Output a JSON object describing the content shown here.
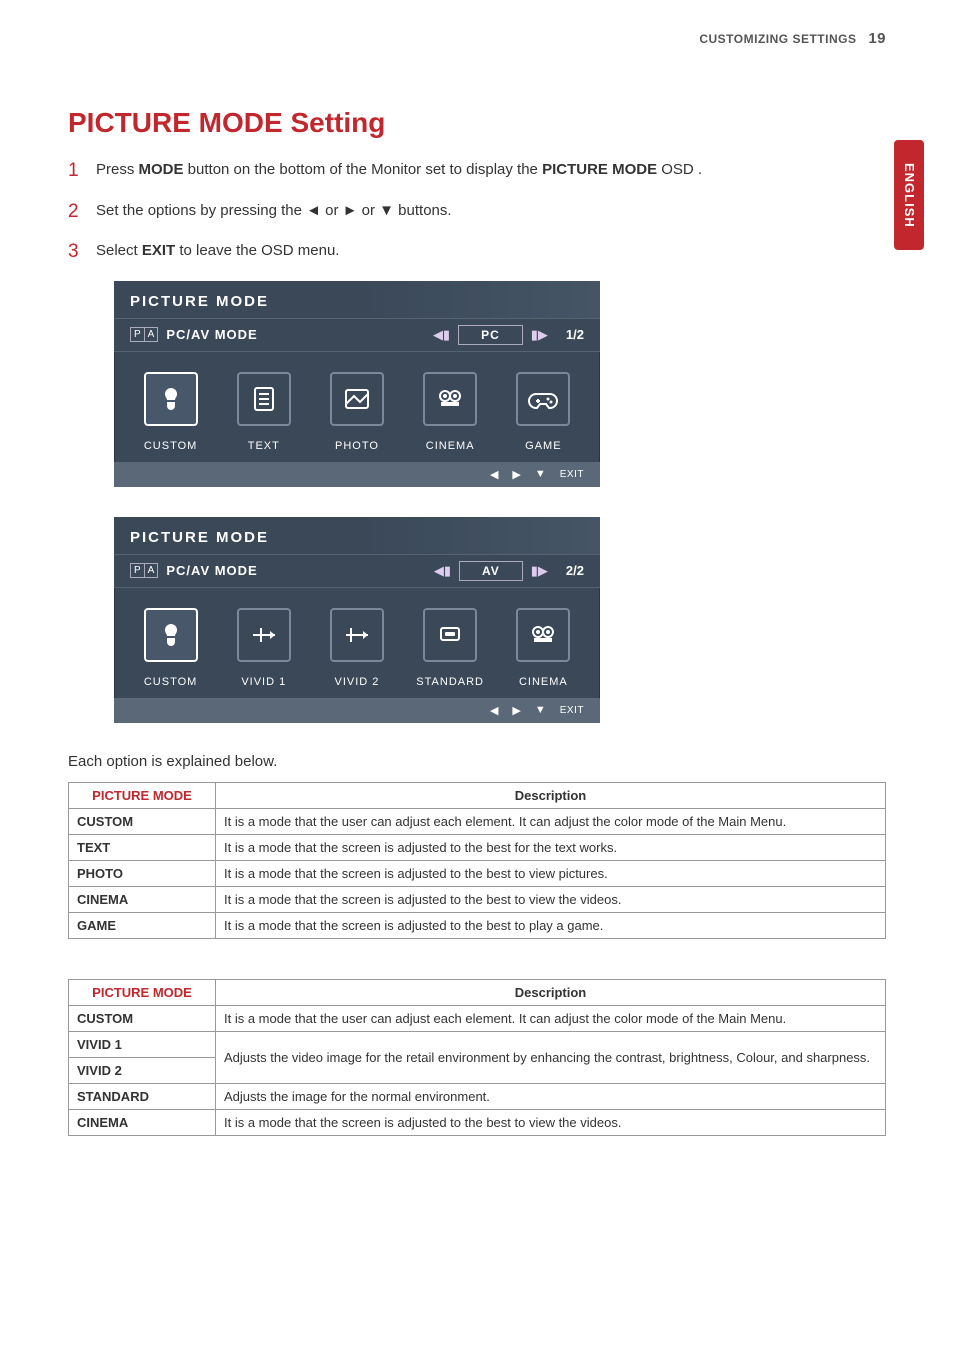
{
  "header": {
    "section": "CUSTOMIZING SETTINGS",
    "page_num": "19"
  },
  "lang_tab": "ENGLISH",
  "heading": "PICTURE MODE Setting",
  "steps": [
    {
      "num": "1",
      "pre": "Press ",
      "b1": "MODE",
      "mid": " button on the bottom of the Monitor set to display the ",
      "b2": "PICTURE MODE",
      "post": " OSD ."
    },
    {
      "num": "2",
      "pre": "Set the options by pressing the ◄ or ► or ▼ buttons.",
      "b1": "",
      "mid": "",
      "b2": "",
      "post": ""
    },
    {
      "num": "3",
      "pre": "Select ",
      "b1": "EXIT",
      "mid": " to leave the OSD menu.",
      "b2": "",
      "post": ""
    }
  ],
  "osd1": {
    "title": "PICTURE  MODE",
    "sub_label": "PC/AV  MODE",
    "value": "PC",
    "page": "1/2",
    "icons": [
      {
        "label": "CUSTOM",
        "glyph": "custom-icon",
        "selected": true
      },
      {
        "label": "TEXT",
        "glyph": "text-icon",
        "selected": false
      },
      {
        "label": "PHOTO",
        "glyph": "photo-icon",
        "selected": false
      },
      {
        "label": "CINEMA",
        "glyph": "cinema-icon",
        "selected": false
      },
      {
        "label": "GAME",
        "glyph": "game-icon",
        "selected": false
      }
    ],
    "foot_exit": "EXIT"
  },
  "osd2": {
    "title": "PICTURE  MODE",
    "sub_label": "PC/AV  MODE",
    "value": "AV",
    "page": "2/2",
    "icons": [
      {
        "label": "CUSTOM",
        "glyph": "custom-icon",
        "selected": true
      },
      {
        "label": "VIVID 1",
        "glyph": "vivid1-icon",
        "selected": false
      },
      {
        "label": "VIVID 2",
        "glyph": "vivid2-icon",
        "selected": false
      },
      {
        "label": "STANDARD",
        "glyph": "standard-icon",
        "selected": false
      },
      {
        "label": "CINEMA",
        "glyph": "cinema-icon",
        "selected": false
      }
    ],
    "foot_exit": "EXIT"
  },
  "explain_text": "Each option is explained below.",
  "table1": {
    "col1": "PICTURE MODE",
    "col2": "Description",
    "rows": [
      {
        "k": "CUSTOM",
        "d": "It is a mode that the user can adjust each element. It can adjust the color mode of the Main Menu."
      },
      {
        "k": "TEXT",
        "d": "It is a mode that the screen is adjusted to the best for the text works."
      },
      {
        "k": "PHOTO",
        "d": "It is a mode that the screen is adjusted to the best to view pictures."
      },
      {
        "k": "CINEMA",
        "d": "It is a mode that the screen is adjusted to the best to view the videos."
      },
      {
        "k": "GAME",
        "d": "It is a mode that the screen is adjusted to the best to play a game."
      }
    ]
  },
  "table2": {
    "col1": "PICTURE MODE",
    "col2": "Description",
    "rows": [
      {
        "k": "CUSTOM",
        "d": "It is a mode that the user can adjust each element. It can adjust the color mode of the Main Menu."
      },
      {
        "k": "VIVID 1",
        "d": "Adjusts the video image for the retail environment by enhancing the contrast, brightness, Colour, and sharpness."
      },
      {
        "k": "VIVID 2",
        "d": ""
      },
      {
        "k": "STANDARD",
        "d": "Adjusts the image for the normal environment."
      },
      {
        "k": "CINEMA",
        "d": "It is a mode that the screen is adjusted to the best to view the videos."
      }
    ]
  }
}
